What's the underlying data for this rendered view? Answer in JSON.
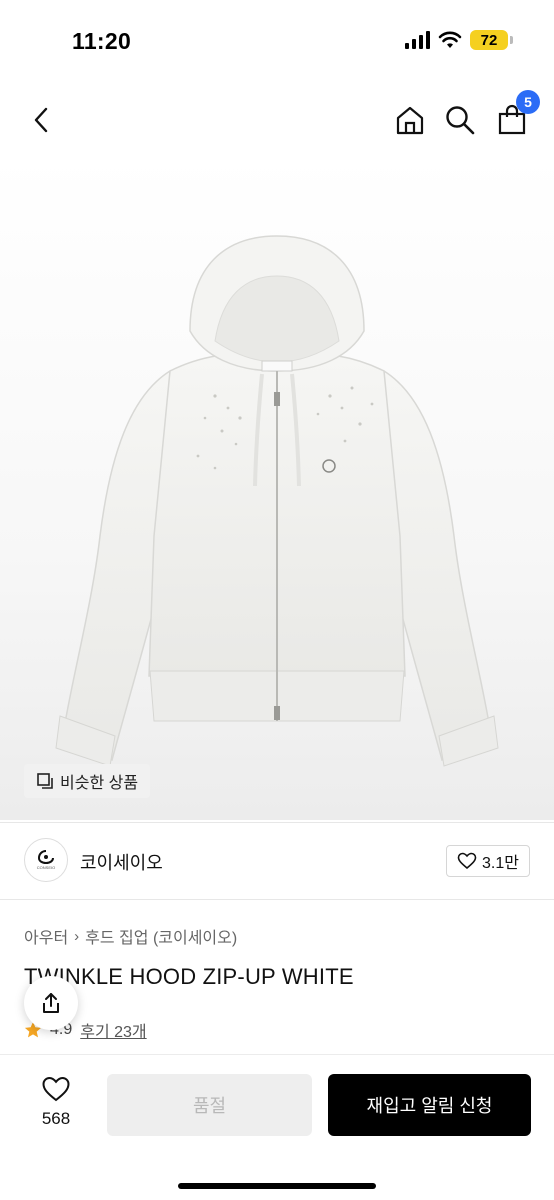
{
  "status_bar": {
    "time": "11:20",
    "battery": "72"
  },
  "header": {
    "cart_count": "5"
  },
  "image": {
    "similar_label": "비슷한 상품",
    "hood_tag": "CONSEIO"
  },
  "brand": {
    "name": "코이세이오",
    "likes": "3.1만"
  },
  "product": {
    "breadcrumb": [
      "아우터",
      "후드 집업 (코이세이오)"
    ],
    "title": "TWINKLE HOOD ZIP-UP WHITE",
    "rating": "4.9",
    "reviews": "후기 23개"
  },
  "bottom": {
    "wish_count": "568",
    "soldout_label": "품절",
    "restock_label": "재입고 알림 신청"
  },
  "colors": {
    "accent_badge": "#2b6cf6",
    "rating_star": "#f5a623",
    "battery": "#f5d020"
  }
}
